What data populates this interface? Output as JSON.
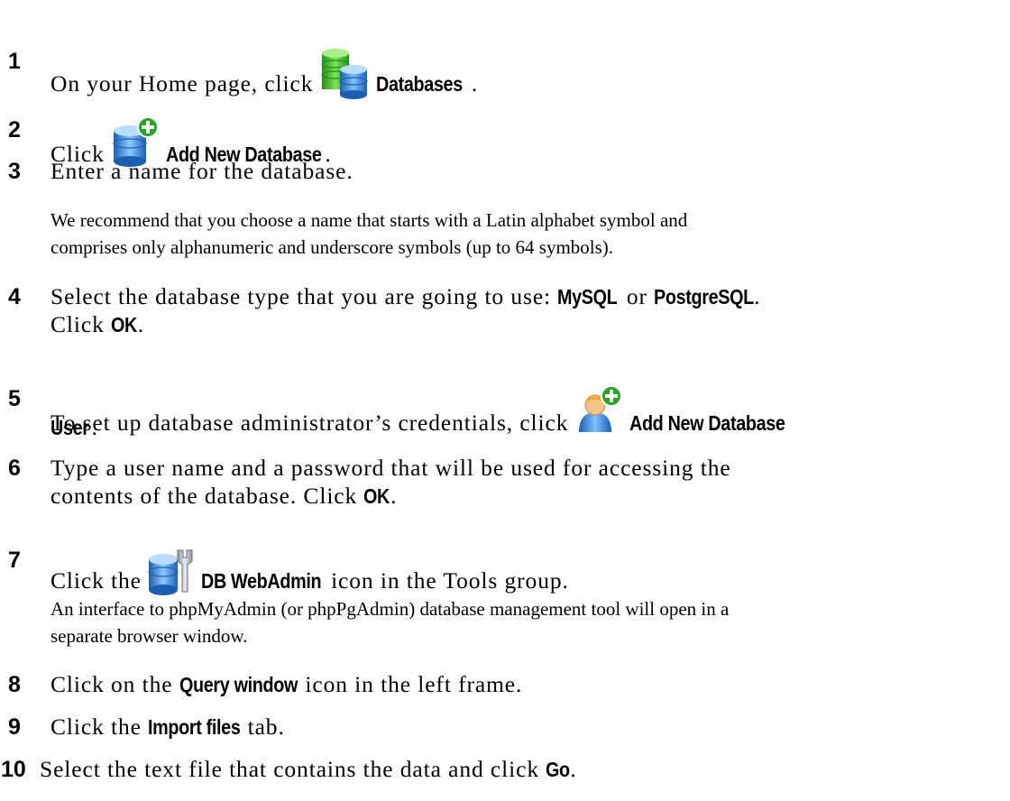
{
  "steps": [
    {
      "num": "1",
      "pre": "On your Home page, click",
      "icon": "databases-icon",
      "ui": "Databases",
      "post": "."
    },
    {
      "num": "2",
      "pre": "Click",
      "icon": "add-database-icon",
      "ui": "Add New Database",
      "post": "."
    },
    {
      "num": "3",
      "text": "Enter a name for the database.",
      "note": [
        "We recommend that you choose a name that starts with a Latin alphabet symbol and",
        "comprises only alphanumeric and underscore symbols (up to 64 symbols)."
      ]
    },
    {
      "num": "4",
      "pre": "Select the database type that you are going to use:",
      "ui1": "MySQL",
      "mid": "or",
      "ui2": "PostgreSQL",
      "post": ".",
      "line2_pre": "Click",
      "line2_ui": "OK",
      "line2_post": "."
    },
    {
      "num": "5",
      "pre": "To set up database administrator’s credentials, click",
      "icon": "add-user-icon",
      "ui": "Add New Database",
      "line2_ui": "User",
      "line2_post": "."
    },
    {
      "num": "6",
      "text": "Type a user name and a password that will be used for accessing the",
      "line2_pre": "contents of the database. Click",
      "line2_ui": "OK",
      "line2_post": "."
    },
    {
      "num": "7",
      "pre": "Click the",
      "icon": "db-webadmin-icon",
      "ui": "DB WebAdmin",
      "post": "icon in the Tools group.",
      "note": [
        "An interface to phpMyAdmin (or phpPgAdmin) database management tool will open in a",
        "separate browser window."
      ]
    },
    {
      "num": "8",
      "pre": "Click on the",
      "ui": "Query window",
      "post": "icon in the left frame."
    },
    {
      "num": "9",
      "pre": "Click the",
      "ui": "Import files",
      "post": "tab."
    },
    {
      "num": "10",
      "pre": "Select the text file that contains the data and click",
      "ui": "Go",
      "post": "."
    }
  ],
  "colors": {
    "green": "#3dbb2e",
    "blue": "#2a7fd4",
    "plus": "#27a327"
  }
}
